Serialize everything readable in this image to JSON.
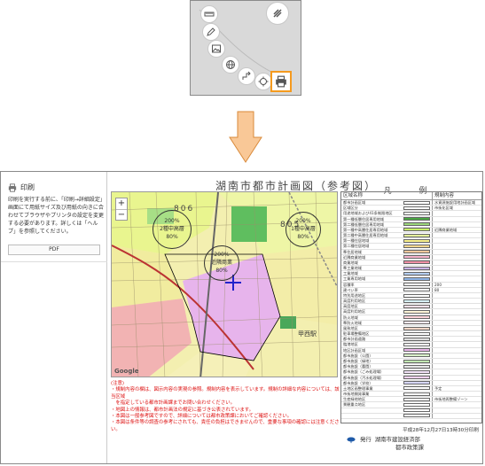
{
  "toolbar": {
    "buttons": [
      {
        "name": "ruler-icon"
      },
      {
        "name": "pencil-icon"
      },
      {
        "name": "image-icon"
      },
      {
        "name": "globe-icon"
      },
      {
        "name": "route-icon"
      },
      {
        "name": "gps-icon"
      },
      {
        "name": "printer-icon"
      }
    ],
    "menu_icon": "menu-icon",
    "highlight_color": "#f59a1e"
  },
  "arrow_color": "#f9c897",
  "print_panel": {
    "heading": "印刷",
    "description": "印刷を実行する前に、「印刷→詳細設定」画面にて用紙サイズ及び用紙の向きに合わせてブラウザやプリンタの設定を変更する必要があります。詳しくは「ヘルプ」を参照してください。",
    "pdf_button": "PDF"
  },
  "paper": {
    "title": "湖南市都市計画図（参考図）",
    "legend_title": "凡 例",
    "legend_headers": {
      "name": "区域名称",
      "content": "規制内容"
    },
    "legend_rows": [
      {
        "name": "都市計画区域",
        "color": "#ffffff",
        "desc": "水資源施設用地計画区域"
      },
      {
        "name": "区域区分",
        "color": "#ffffff",
        "desc": "市街化区域"
      },
      {
        "name": "用途地域および41条制限地区",
        "color": "#ffffff",
        "desc": ""
      },
      {
        "name": "第一種低層住居専用地域",
        "color": "#49a543",
        "desc": ""
      },
      {
        "name": "第二種低層住居専用地域",
        "color": "#9ad67a",
        "desc": ""
      },
      {
        "name": "第一種中高層住居専用地域",
        "color": "#c7ef67",
        "desc": "近隣商業地域"
      },
      {
        "name": "第二種中高層住居専用地域",
        "color": "#e6f79b",
        "desc": ""
      },
      {
        "name": "第一種住居地域",
        "color": "#f8f08a",
        "desc": ""
      },
      {
        "name": "第二種住居地域",
        "color": "#f7d88f",
        "desc": ""
      },
      {
        "name": "準住居地域",
        "color": "#f5c89c",
        "desc": ""
      },
      {
        "name": "近隣商業地域",
        "color": "#f6b2cc",
        "desc": ""
      },
      {
        "name": "商業地域",
        "color": "#f08fa5",
        "desc": ""
      },
      {
        "name": "準工業地域",
        "color": "#c9b3e6",
        "desc": ""
      },
      {
        "name": "工業地域",
        "color": "#b3cdf0",
        "desc": ""
      },
      {
        "name": "工業専用地域",
        "color": "#8eb4e6",
        "desc": ""
      },
      {
        "name": "容積率",
        "color": "#ffffff",
        "desc": "200"
      },
      {
        "name": "建ぺい率",
        "color": "#ffffff",
        "desc": "80"
      },
      {
        "name": "特別用途地区",
        "color": "#ffffff",
        "desc": ""
      },
      {
        "name": "高度利用地区",
        "color": "#d9f2f7",
        "desc": ""
      },
      {
        "name": "高度地区",
        "color": "#ffe0e8",
        "desc": ""
      },
      {
        "name": "高度利用地区",
        "color": "#fff4d6",
        "desc": ""
      },
      {
        "name": "防火地域",
        "color": "#ffd3da",
        "desc": ""
      },
      {
        "name": "準防火地域",
        "color": "#ffe9ee",
        "desc": ""
      },
      {
        "name": "風致地区",
        "color": "#f3d6c6",
        "desc": ""
      },
      {
        "name": "駐車場整備地区",
        "color": "#ffffff",
        "desc": ""
      },
      {
        "name": "都市計画道路",
        "color": "#dddddd",
        "desc": ""
      },
      {
        "name": "臨港地区",
        "color": "#ffffff",
        "desc": ""
      },
      {
        "name": "地区計画区域",
        "color": "#e8b4e8",
        "desc": ""
      },
      {
        "name": "都市施設（公園）",
        "color": "#d8f0c8",
        "desc": ""
      },
      {
        "name": "都市施設（緑地）",
        "color": "#c2e8b2",
        "desc": ""
      },
      {
        "name": "都市施設（墓園）",
        "color": "#e6e6e6",
        "desc": ""
      },
      {
        "name": "都市施設（ごみ処理場）",
        "color": "#f0e0f6",
        "desc": ""
      },
      {
        "name": "都市施設（汚水処理場）",
        "color": "#f6d2f0",
        "desc": ""
      },
      {
        "name": "都市施設（学校）",
        "color": "#d6d6ff",
        "desc": ""
      },
      {
        "name": "土地区画整理事業",
        "color": "#ffffff",
        "desc": "予定"
      },
      {
        "name": "市街地開発事業",
        "color": "#ffffff",
        "desc": ""
      },
      {
        "name": "生産緑地地区",
        "color": "#ffffff",
        "desc": "市街地再整備ゾーン"
      },
      {
        "name": "景観重点地区",
        "color": "#ffffff",
        "desc": ""
      },
      {
        "name": "",
        "color": "#ffffff",
        "desc": ""
      },
      {
        "name": "",
        "color": "#ffffff",
        "desc": ""
      }
    ],
    "issue_date": "平成28年12月27日13時30分印刷",
    "issuer_label": "発行",
    "issuer_name": "湖南市建設経済部",
    "issuer_dept": "都市政策課",
    "map": {
      "zoom_in": "+",
      "zoom_out": "−",
      "google": "Google",
      "labels": [
        {
          "text": "806"
        },
        {
          "text": "805"
        },
        {
          "text": "公園"
        },
        {
          "text": "近隣商業"
        },
        {
          "text": "2種中高層"
        },
        {
          "text": "1種中高層"
        },
        {
          "text": "甲西駅"
        },
        {
          "text": "石部"
        }
      ],
      "zones": [
        {
          "label": "200%",
          "sub": "2種中高層",
          "pct": "80%"
        },
        {
          "label": "200%",
          "sub": "近隣商業",
          "pct": "80%"
        },
        {
          "label": "200%",
          "sub": "1種中高層",
          "pct": "80%"
        }
      ]
    },
    "notes": [
      "(注意)",
      "・規制内容の欄は、図示内容の実現の参照。規制内容を表示しています。規制の詳細な内容については、該当区域",
      "　を指定している都市計画課までお問い合わせください。",
      "・地図上の情報は、都市計画法の規定に基づき公表されています。",
      "・本図は一般参考図ですので、詳細については都市政策課においてご確認ください。",
      "・本図は条件等の調査の参考にされても、責任の負担はできませんので、重要な事項の確認には注意ください。"
    ]
  }
}
